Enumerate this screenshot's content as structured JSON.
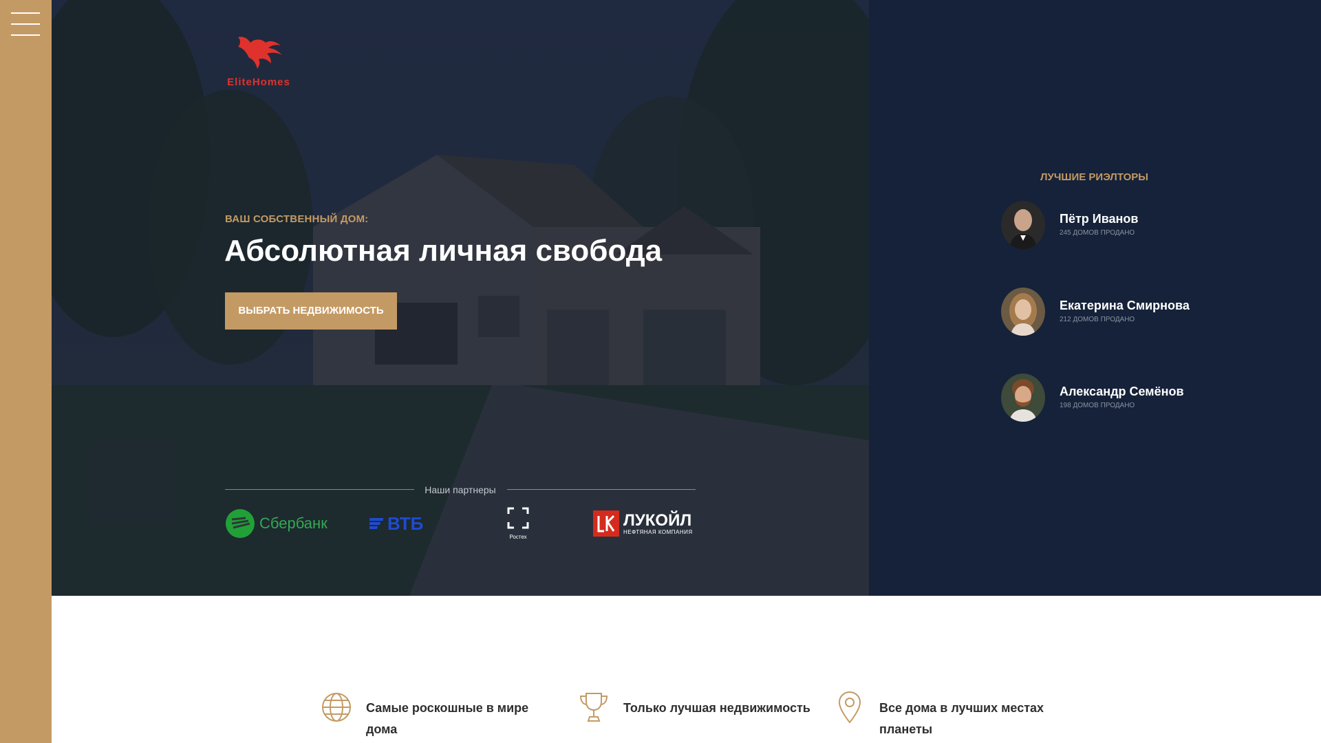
{
  "brand": {
    "name": "EliteHomes",
    "accent": "#c49a64",
    "logo_color": "#e0322c",
    "panel_color": "#152239"
  },
  "nav": {
    "menu_icon": "hamburger-menu-icon"
  },
  "hero": {
    "kicker": "ВАШ СОБСТВЕННЫЙ ДОМ:",
    "headline": "Абсолютная личная свобода",
    "cta_label": "ВЫБРАТЬ НЕДВИЖИМОСТЬ"
  },
  "partners": {
    "title": "Наши партнеры",
    "items": [
      {
        "name": "Сбербанк",
        "icon": "sberbank-logo"
      },
      {
        "name": "ВТБ",
        "icon": "vtb-logo"
      },
      {
        "name": "Ростех",
        "icon": "rostec-logo"
      },
      {
        "name": "ЛУКОЙЛ",
        "subtitle": "НЕФТЯНАЯ КОМПАНИЯ",
        "icon": "lukoil-logo"
      }
    ]
  },
  "realtors": {
    "title": "ЛУЧШИЕ РИЭЛТОРЫ",
    "items": [
      {
        "name": "Пётр Иванов",
        "sub": "245 ДОМОВ ПРОДАНО"
      },
      {
        "name": "Екатерина Смирнова",
        "sub": "212 ДОМОВ ПРОДАНО"
      },
      {
        "name": "Александр Семёнов",
        "sub": "198 ДОМОВ ПРОДАНО"
      }
    ]
  },
  "features": [
    {
      "icon": "globe-icon",
      "text": "Самые роскошные в мире дома"
    },
    {
      "icon": "trophy-icon",
      "text": "Только лучшая недвижимость"
    },
    {
      "icon": "location-pin-icon",
      "text": "Все дома в лучших местах планеты"
    }
  ]
}
